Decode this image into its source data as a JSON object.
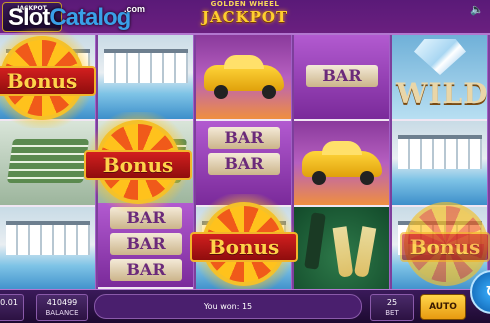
{
  "header": {
    "jackpot_badge_title": "JACKPOT",
    "watermark_part1": "Slot",
    "watermark_part2": "Catalog",
    "watermark_suffix": ".com",
    "game_title_small": "GOLDEN WHEEL",
    "game_title_big": "JACKPOT",
    "sound_icon": "speaker-icon"
  },
  "symbols": {
    "bar_label": "BAR",
    "wild_label": "WILD",
    "bonus_label": "Bonus"
  },
  "reels": [
    {
      "cells": [
        "bonus",
        "money",
        "pool"
      ]
    },
    {
      "cells": [
        "pool",
        "bonus",
        "bar"
      ]
    },
    {
      "cells": [
        "car",
        "bar",
        "bonus"
      ]
    },
    {
      "cells": [
        "bar",
        "car",
        "bottle"
      ]
    },
    {
      "cells": [
        "wild",
        "pool",
        "bonus"
      ]
    }
  ],
  "footer": {
    "bet_value": "0.01",
    "bet_caption": "",
    "balance_value": "410499",
    "balance_caption": "BALANCE",
    "win_message": "You won: 15",
    "lines_value": "25",
    "lines_caption": "BET",
    "auto_label": "AUTO",
    "spin_icon": "spin-icon"
  },
  "colors": {
    "accent_gold": "#ffcf2e",
    "frame_purple": "#7d3f9c",
    "bonus_red": "#d21f1f"
  }
}
